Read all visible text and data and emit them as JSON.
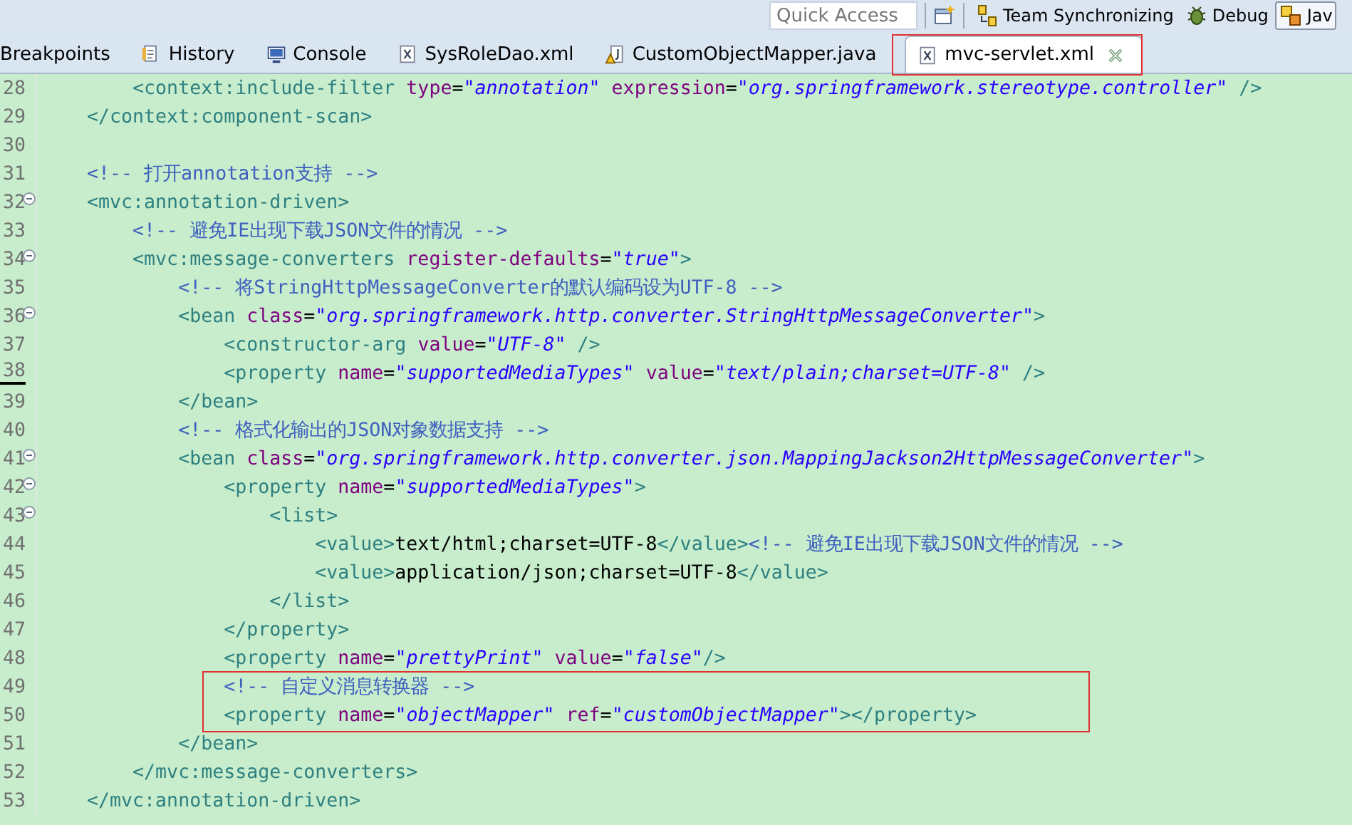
{
  "toolbar": {
    "quick_access": {
      "placeholder": "Quick Access"
    },
    "perspectives": [
      {
        "label": "Team Synchronizing",
        "kind": "team",
        "selected": false
      },
      {
        "label": "Debug",
        "kind": "debug",
        "selected": false
      },
      {
        "label": "Jav",
        "kind": "java",
        "selected": true
      }
    ]
  },
  "tabs": [
    {
      "label": "Breakpoints",
      "kind": "view",
      "selected": false
    },
    {
      "label": "History",
      "kind": "history",
      "selected": false
    },
    {
      "label": "Console",
      "kind": "console",
      "selected": false
    },
    {
      "label": "SysRoleDao.xml",
      "kind": "xml",
      "selected": false
    },
    {
      "label": "CustomObjectMapper.java",
      "kind": "java",
      "selected": false
    },
    {
      "label": "mvc-servlet.xml",
      "kind": "xml",
      "selected": true
    }
  ],
  "editor": {
    "lines": [
      {
        "number": "28",
        "foldable": false,
        "current": false,
        "tokens": [
          {
            "kind": "tag",
            "text": "        <context:include-filter"
          },
          {
            "kind": "attr",
            "text": " type"
          },
          {
            "kind": "plain",
            "text": "="
          },
          {
            "kind": "string",
            "text": "\"annotation\""
          },
          {
            "kind": "attr",
            "text": " expression"
          },
          {
            "kind": "plain",
            "text": "="
          },
          {
            "kind": "string",
            "text": "\"org.springframework.stereotype.controller\""
          },
          {
            "kind": "tag",
            "text": " />"
          }
        ]
      },
      {
        "number": "29",
        "foldable": false,
        "current": false,
        "tokens": [
          {
            "kind": "tag",
            "text": "    </context:component-scan>"
          }
        ]
      },
      {
        "number": "30",
        "foldable": false,
        "current": false
      },
      {
        "number": "31",
        "foldable": false,
        "current": false,
        "tokens": [
          {
            "kind": "comment",
            "text": "    <!-- 打开annotation支持 -->"
          }
        ]
      },
      {
        "number": "32",
        "foldable": true,
        "current": false,
        "tokens": [
          {
            "kind": "tag",
            "text": "    <mvc:annotation-driven>"
          }
        ]
      },
      {
        "number": "33",
        "foldable": false,
        "current": false,
        "tokens": [
          {
            "kind": "comment",
            "text": "        <!-- 避免IE出现下载JSON文件的情况 -->"
          }
        ]
      },
      {
        "number": "34",
        "foldable": true,
        "current": false,
        "tokens": [
          {
            "kind": "tag",
            "text": "        <mvc:message-converters"
          },
          {
            "kind": "attr",
            "text": " register-defaults"
          },
          {
            "kind": "plain",
            "text": "="
          },
          {
            "kind": "string",
            "text": "\"true\""
          },
          {
            "kind": "tag",
            "text": ">"
          }
        ]
      },
      {
        "number": "35",
        "foldable": false,
        "current": false,
        "tokens": [
          {
            "kind": "comment",
            "text": "            <!-- 将StringHttpMessageConverter的默认编码设为UTF-8 -->"
          }
        ]
      },
      {
        "number": "36",
        "foldable": true,
        "current": false,
        "tokens": [
          {
            "kind": "tag",
            "text": "            <bean"
          },
          {
            "kind": "attr",
            "text": " class"
          },
          {
            "kind": "plain",
            "text": "="
          },
          {
            "kind": "string",
            "text": "\"org.springframework.http.converter.StringHttpMessageConverter\""
          },
          {
            "kind": "tag",
            "text": ">"
          }
        ]
      },
      {
        "number": "37",
        "foldable": false,
        "current": false,
        "tokens": [
          {
            "kind": "tag",
            "text": "                <constructor-arg"
          },
          {
            "kind": "attr",
            "text": " value"
          },
          {
            "kind": "plain",
            "text": "="
          },
          {
            "kind": "string",
            "text": "\"UTF-8\""
          },
          {
            "kind": "tag",
            "text": " />"
          }
        ]
      },
      {
        "number": "38",
        "foldable": false,
        "current": true,
        "tokens": [
          {
            "kind": "tag",
            "text": "                <property"
          },
          {
            "kind": "attr",
            "text": " name"
          },
          {
            "kind": "plain",
            "text": "="
          },
          {
            "kind": "string",
            "text": "\"supportedMediaTypes\""
          },
          {
            "kind": "attr",
            "text": " value"
          },
          {
            "kind": "plain",
            "text": "="
          },
          {
            "kind": "string",
            "text": "\"text/plain;charset=UTF-8\""
          },
          {
            "kind": "tag",
            "text": " />"
          }
        ]
      },
      {
        "number": "39",
        "foldable": false,
        "current": false,
        "tokens": [
          {
            "kind": "tag",
            "text": "            </bean>"
          }
        ]
      },
      {
        "number": "40",
        "foldable": false,
        "current": false,
        "tokens": [
          {
            "kind": "comment",
            "text": "            <!-- 格式化输出的JSON对象数据支持 -->"
          }
        ]
      },
      {
        "number": "41",
        "foldable": true,
        "current": false,
        "tokens": [
          {
            "kind": "tag",
            "text": "            <bean"
          },
          {
            "kind": "attr",
            "text": " class"
          },
          {
            "kind": "plain",
            "text": "="
          },
          {
            "kind": "string",
            "text": "\"org.springframework.http.converter.json.MappingJackson2HttpMessageConverter\""
          },
          {
            "kind": "tag",
            "text": ">"
          }
        ]
      },
      {
        "number": "42",
        "foldable": true,
        "current": false,
        "tokens": [
          {
            "kind": "tag",
            "text": "                <property"
          },
          {
            "kind": "attr",
            "text": " name"
          },
          {
            "kind": "plain",
            "text": "="
          },
          {
            "kind": "string",
            "text": "\"supportedMediaTypes\""
          },
          {
            "kind": "tag",
            "text": ">"
          }
        ]
      },
      {
        "number": "43",
        "foldable": true,
        "current": false,
        "tokens": [
          {
            "kind": "tag",
            "text": "                    <list>"
          }
        ]
      },
      {
        "number": "44",
        "foldable": false,
        "current": false,
        "tokens": [
          {
            "kind": "tag",
            "text": "                        <value>"
          },
          {
            "kind": "plain",
            "text": "text/html;charset=UTF-8"
          },
          {
            "kind": "tag",
            "text": "</value>"
          },
          {
            "kind": "comment",
            "text": "<!-- 避免IE出现下载JSON文件的情况 -->"
          }
        ]
      },
      {
        "number": "45",
        "foldable": false,
        "current": false,
        "tokens": [
          {
            "kind": "tag",
            "text": "                        <value>"
          },
          {
            "kind": "plain",
            "text": "application/json;charset=UTF-8"
          },
          {
            "kind": "tag",
            "text": "</value>"
          }
        ]
      },
      {
        "number": "46",
        "foldable": false,
        "current": false,
        "tokens": [
          {
            "kind": "tag",
            "text": "                    </list>"
          }
        ]
      },
      {
        "number": "47",
        "foldable": false,
        "current": false,
        "tokens": [
          {
            "kind": "tag",
            "text": "                </property>"
          }
        ]
      },
      {
        "number": "48",
        "foldable": false,
        "current": false,
        "tokens": [
          {
            "kind": "tag",
            "text": "                <property"
          },
          {
            "kind": "attr",
            "text": " name"
          },
          {
            "kind": "plain",
            "text": "="
          },
          {
            "kind": "string",
            "text": "\"prettyPrint\""
          },
          {
            "kind": "attr",
            "text": " value"
          },
          {
            "kind": "plain",
            "text": "="
          },
          {
            "kind": "string",
            "text": "\"false\""
          },
          {
            "kind": "tag",
            "text": "/>"
          }
        ]
      },
      {
        "number": "49",
        "foldable": false,
        "current": false,
        "tokens": [
          {
            "kind": "comment",
            "text": "                <!-- 自定义消息转换器 -->"
          }
        ]
      },
      {
        "number": "50",
        "foldable": false,
        "current": false,
        "tokens": [
          {
            "kind": "tag",
            "text": "                <property"
          },
          {
            "kind": "attr",
            "text": " name"
          },
          {
            "kind": "plain",
            "text": "="
          },
          {
            "kind": "string",
            "text": "\"objectMapper\""
          },
          {
            "kind": "attr",
            "text": " ref"
          },
          {
            "kind": "plain",
            "text": "="
          },
          {
            "kind": "string",
            "text": "\"customObjectMapper\""
          },
          {
            "kind": "tag",
            "text": "></property>"
          }
        ]
      },
      {
        "number": "51",
        "foldable": false,
        "current": false,
        "tokens": [
          {
            "kind": "tag",
            "text": "            </bean>"
          }
        ]
      },
      {
        "number": "52",
        "foldable": false,
        "current": false,
        "tokens": [
          {
            "kind": "tag",
            "text": "        </mvc:message-converters>"
          }
        ]
      },
      {
        "number": "53",
        "foldable": false,
        "current": false,
        "tokens": [
          {
            "kind": "tag",
            "text": "    </mvc:annotation-driven>"
          }
        ]
      }
    ]
  }
}
